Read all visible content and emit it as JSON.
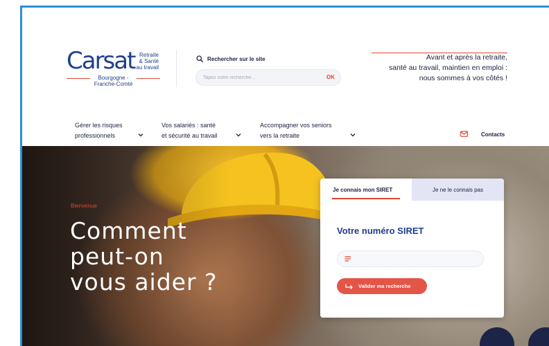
{
  "logo": {
    "name": "Carsat",
    "side_lines": [
      "Retraite",
      "& Santé",
      "au travail"
    ],
    "region_lines": [
      "Bourgogne -",
      "Franche-Comté"
    ]
  },
  "search": {
    "label": "Rechercher sur le site",
    "placeholder": "Tapez votre recherche...",
    "submit_label": "OK"
  },
  "tagline": {
    "lines": [
      "Avant et après la retraite,",
      "santé au travail, maintien en emploi :",
      "nous sommes à vos côtés !"
    ]
  },
  "nav": {
    "items": [
      {
        "line1": "Gérer les risques",
        "line2": "professionnels",
        "icon": "chevron-down-icon"
      },
      {
        "line1": "Vos salariés : santé",
        "line2": "et sécurité au travail",
        "icon": "chevron-down-icon"
      },
      {
        "line1": "Accompagner vos seniors",
        "line2": "vers la retraite",
        "icon": "chevron-down-icon"
      }
    ],
    "contacts_label": "Contacts",
    "contacts_icon": "mail-icon"
  },
  "hero": {
    "eyebrow": "Bienvenue",
    "title_lines": [
      "Comment",
      "peut-on",
      "vous aider ?"
    ]
  },
  "siret": {
    "tabs": [
      {
        "label": "Je connais mon SIRET",
        "active": true
      },
      {
        "label": "Je ne le connais pas",
        "active": false
      }
    ],
    "title": "Votre numéro SIRET",
    "input_value": "",
    "submit_label": "Valider ma recherche"
  },
  "colors": {
    "brand_blue": "#1f3f8c",
    "accent_red": "#e0452f",
    "frame_blue": "#2b8fd6",
    "dark_navy": "#1c2547"
  }
}
